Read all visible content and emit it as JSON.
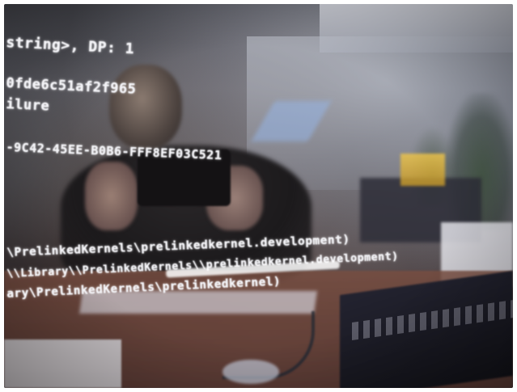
{
  "photo": {
    "description_icon": "camera-photo-of-screen",
    "colors": {
      "text": "#f4f4f8",
      "desk": "#7a4e44",
      "synth_accent": "#f2c84a"
    }
  },
  "terminal": {
    "lines": [
      "string>, DP: 1",
      "0fde6c51af2f965",
      "ilure",
      "-9C42-45EE-B0B6-FFF8EF03C521",
      "\\PrelinkedKernels\\prelinkedkernel.development)",
      "\\\\Library\\\\PrelinkedKernels\\\\prelinkedkernel.development)",
      "ary\\PrelinkedKernels\\prelinkedkernel)"
    ]
  }
}
